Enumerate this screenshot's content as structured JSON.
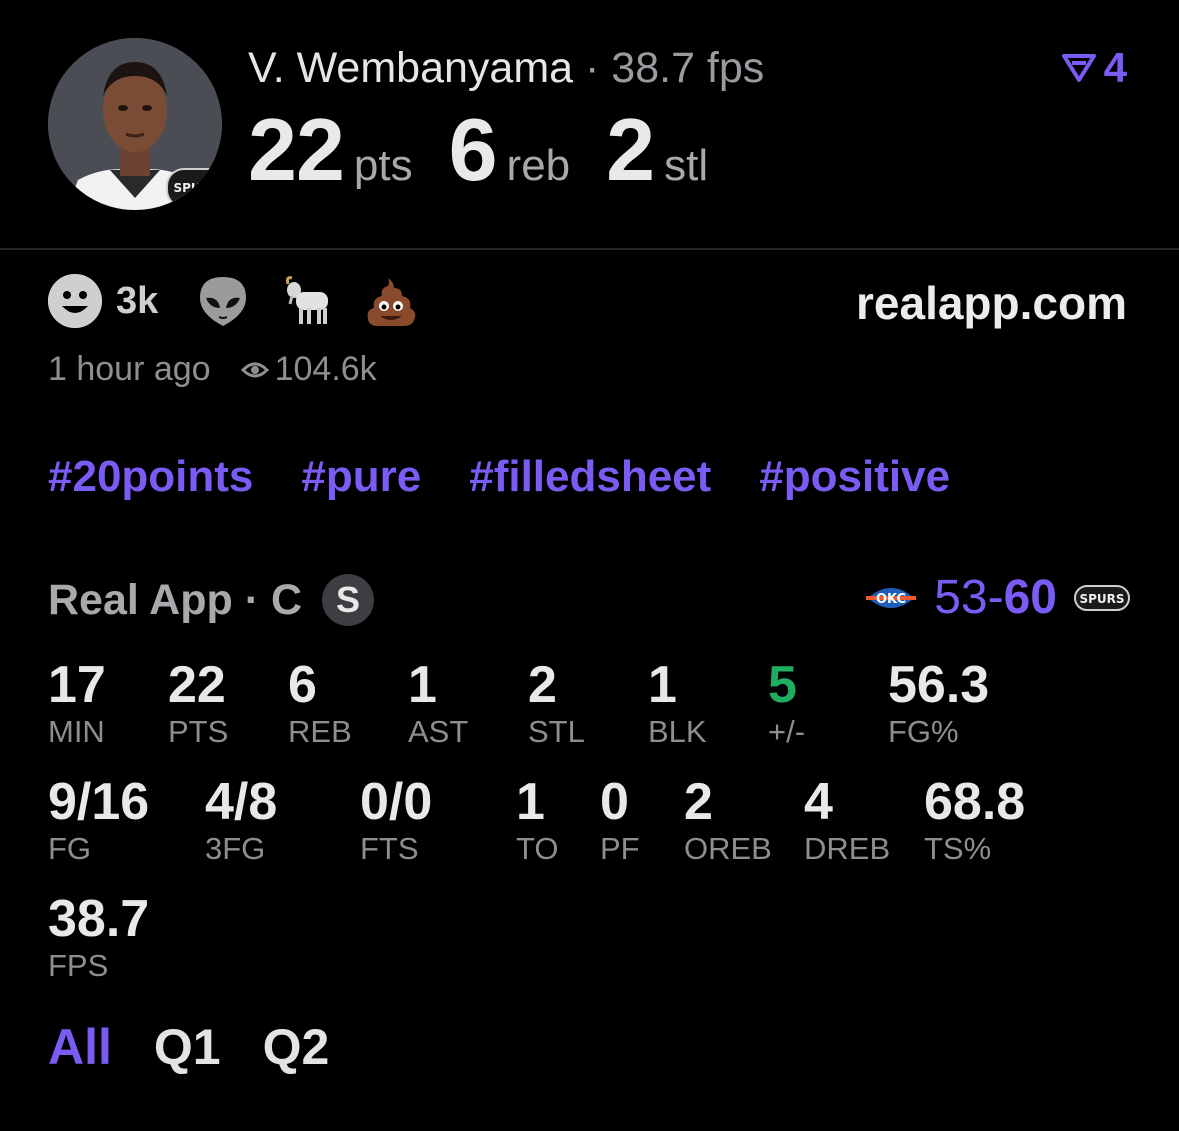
{
  "player": {
    "name": "V. Wembanyama",
    "separator": "·",
    "fps_line": "38.7 fps",
    "big_stats": [
      {
        "value": "22",
        "unit": "pts"
      },
      {
        "value": "6",
        "unit": "reb"
      },
      {
        "value": "2",
        "unit": "stl"
      }
    ],
    "team_logo_text": "SPURS"
  },
  "vote": {
    "count": "4",
    "icon": "vote-arrow-icon"
  },
  "reactions": {
    "count": "3k",
    "items": [
      "smile-icon",
      "alien-icon",
      "goat-icon",
      "poop-icon"
    ]
  },
  "site": "realapp.com",
  "meta": {
    "time": "1 hour ago",
    "views": "104.6k"
  },
  "tags": [
    "#20points",
    "#pure",
    "#filledsheet",
    "#positive"
  ],
  "realapp": {
    "label": "Real App · C",
    "badge": "S"
  },
  "score": {
    "away_logo": "OKC",
    "away": "53",
    "dash": "-",
    "home": "60",
    "home_logo": "SPURS"
  },
  "stats_row1": [
    {
      "value": "17",
      "label": "MIN"
    },
    {
      "value": "22",
      "label": "PTS"
    },
    {
      "value": "6",
      "label": "REB"
    },
    {
      "value": "1",
      "label": "AST"
    },
    {
      "value": "2",
      "label": "STL"
    },
    {
      "value": "1",
      "label": "BLK"
    },
    {
      "value": "5",
      "label": "+/-"
    },
    {
      "value": "56.3",
      "label": "FG%"
    }
  ],
  "stats_row2": [
    {
      "value": "9/16",
      "label": "FG"
    },
    {
      "value": "4/8",
      "label": "3FG"
    },
    {
      "value": "0/0",
      "label": "FTS"
    },
    {
      "value": "1",
      "label": "TO"
    },
    {
      "value": "0",
      "label": "PF"
    },
    {
      "value": "2",
      "label": "OREB"
    },
    {
      "value": "4",
      "label": "DREB"
    },
    {
      "value": "68.8",
      "label": "TS%"
    }
  ],
  "stats_row3": [
    {
      "value": "38.7",
      "label": "FPS"
    }
  ],
  "tabs": [
    "All",
    "Q1",
    "Q2"
  ],
  "colors": {
    "accent": "#7a5cf5",
    "positive": "#1fae5f"
  }
}
